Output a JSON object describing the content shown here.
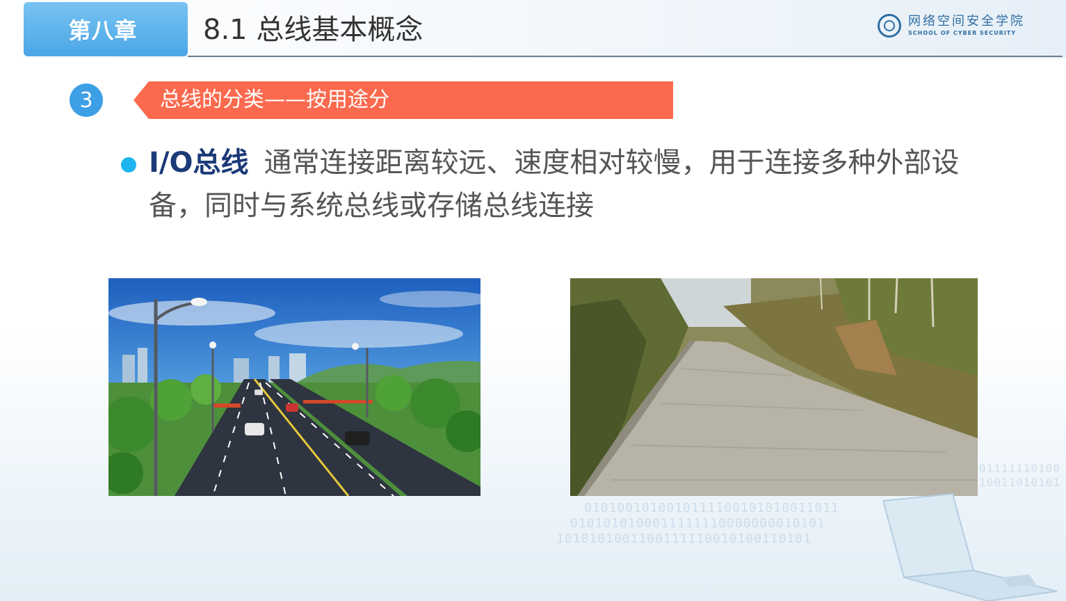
{
  "header": {
    "chapter_label": "第八章",
    "title": "8.1 总线基本概念",
    "logo_cn": "网络空间安全学院",
    "logo_en": "SCHOOL OF CYBER SECURITY"
  },
  "section": {
    "number": "3",
    "heading": "总线的分类——按用途分"
  },
  "bullet": {
    "term": "I/O总线",
    "text": "通常连接距离较远、速度相对较慢，用于连接多种外部设备，同时与系统总线或存储总线连接"
  },
  "images": [
    {
      "icon": "highway-illustration"
    },
    {
      "icon": "rural-road-photo"
    }
  ],
  "colors": {
    "chapter_tab": "#4aa6e6",
    "banner": "#fb6a4e",
    "badge": "#3d9fe6",
    "bullet_dot": "#1eb4ee",
    "term": "#1c3a78"
  },
  "decoration": {
    "binary_lines": [
      "0101001010010111100101010011011",
      "0101010100011111110000000010101",
      "1010101001100111110010100110101",
      "01111110100",
      "10011010101"
    ]
  }
}
